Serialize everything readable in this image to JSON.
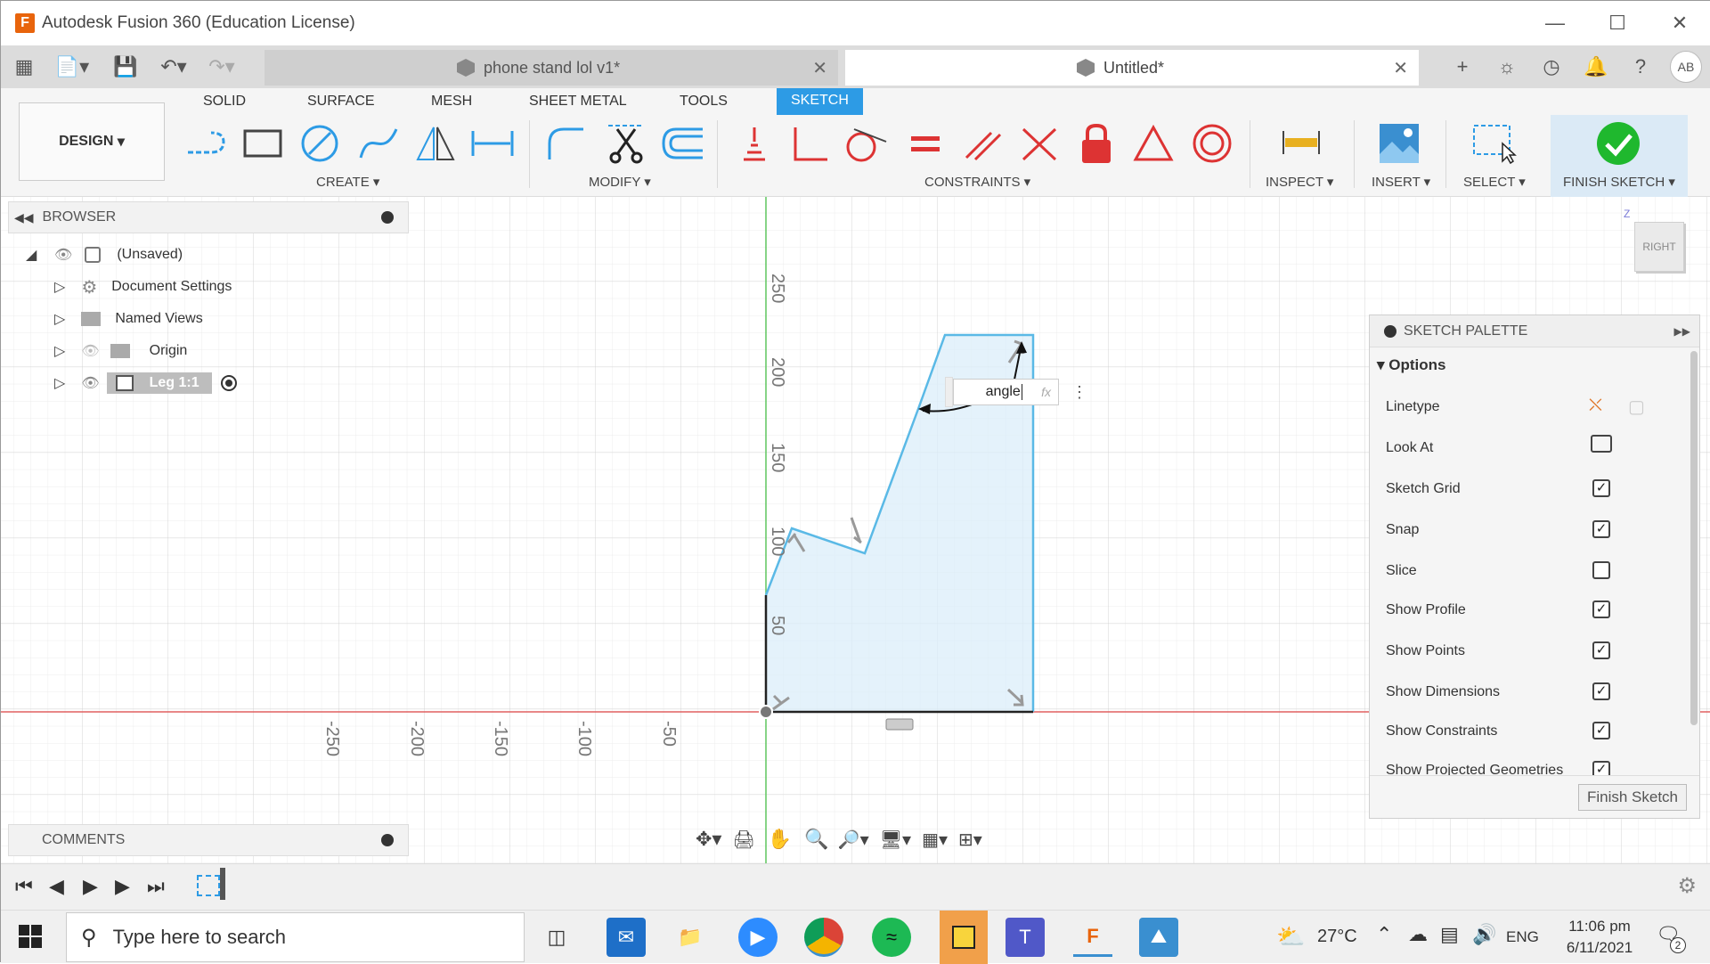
{
  "window": {
    "title": "Autodesk Fusion 360 (Education License)",
    "app_letter": "F"
  },
  "tabs": [
    {
      "label": "phone stand lol v1*"
    },
    {
      "label": "Untitled*"
    }
  ],
  "user_initials": "AB",
  "toolbar": {
    "workspace": "DESIGN",
    "ws_tabs": [
      "SOLID",
      "SURFACE",
      "MESH",
      "SHEET METAL",
      "TOOLS",
      "SKETCH"
    ],
    "groups": {
      "create": "CREATE",
      "modify": "MODIFY",
      "constraints": "CONSTRAINTS",
      "inspect": "INSPECT",
      "insert": "INSERT",
      "select": "SELECT",
      "finish": "FINISH SKETCH"
    }
  },
  "browser": {
    "title": "BROWSER",
    "items": [
      {
        "label": "(Unsaved)"
      },
      {
        "label": "Document Settings"
      },
      {
        "label": "Named Views"
      },
      {
        "label": "Origin"
      },
      {
        "label": "Leg 1:1"
      }
    ]
  },
  "comments": {
    "title": "COMMENTS"
  },
  "viewcube": {
    "face": "RIGHT",
    "axis_z": "Z"
  },
  "dimension_input": {
    "value": "angle",
    "fx": "fx"
  },
  "axis_ticks_vertical": [
    "250",
    "200",
    "150",
    "100",
    "50"
  ],
  "axis_ticks_horizontal": [
    "-250",
    "-200",
    "-150",
    "-100",
    "-50"
  ],
  "palette": {
    "title": "SKETCH PALETTE",
    "section": "Options",
    "rows": [
      {
        "label": "Linetype",
        "checked": null
      },
      {
        "label": "Look At",
        "checked": null
      },
      {
        "label": "Sketch Grid",
        "checked": true
      },
      {
        "label": "Snap",
        "checked": true
      },
      {
        "label": "Slice",
        "checked": false
      },
      {
        "label": "Show Profile",
        "checked": true
      },
      {
        "label": "Show Points",
        "checked": true
      },
      {
        "label": "Show Dimensions",
        "checked": true
      },
      {
        "label": "Show Constraints",
        "checked": true
      },
      {
        "label": "Show Projected Geometries",
        "checked": true
      }
    ],
    "finish_button": "Finish Sketch"
  },
  "taskbar": {
    "search_placeholder": "Type here to search",
    "weather": "27°C",
    "lang": "ENG",
    "time": "11:06 pm",
    "date": "6/11/2021",
    "notif_count": "2"
  },
  "colors": {
    "accent": "#2d9be5",
    "sketch_line": "#5ab9e6",
    "profile_fill": "#dbeef9",
    "x_axis": "#e06060",
    "y_axis": "#5ec65e"
  }
}
